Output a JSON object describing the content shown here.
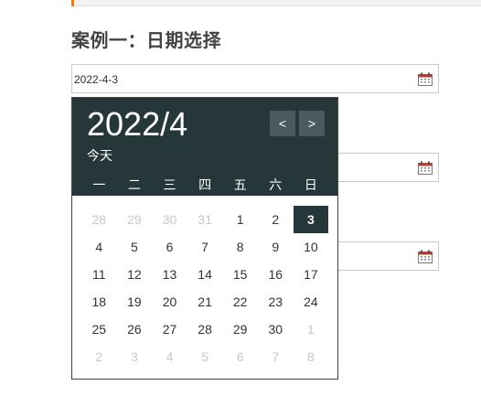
{
  "heading": "案例一：日期选择",
  "inputs": [
    {
      "value": "2022-4-3"
    },
    {
      "value": ""
    },
    {
      "value": ""
    }
  ],
  "picker": {
    "year_month": "2022/4",
    "today_label": "今天",
    "prev_label": "<",
    "next_label": ">",
    "weekdays": [
      "一",
      "二",
      "三",
      "四",
      "五",
      "六",
      "日"
    ],
    "selected_day": "3",
    "days": [
      {
        "label": "28",
        "other": true
      },
      {
        "label": "29",
        "other": true
      },
      {
        "label": "30",
        "other": true
      },
      {
        "label": "31",
        "other": true
      },
      {
        "label": "1"
      },
      {
        "label": "2"
      },
      {
        "label": "3",
        "selected": true
      },
      {
        "label": "4"
      },
      {
        "label": "5"
      },
      {
        "label": "6"
      },
      {
        "label": "7"
      },
      {
        "label": "8"
      },
      {
        "label": "9"
      },
      {
        "label": "10"
      },
      {
        "label": "11"
      },
      {
        "label": "12"
      },
      {
        "label": "13"
      },
      {
        "label": "14"
      },
      {
        "label": "15"
      },
      {
        "label": "16"
      },
      {
        "label": "17"
      },
      {
        "label": "18"
      },
      {
        "label": "19"
      },
      {
        "label": "20"
      },
      {
        "label": "21"
      },
      {
        "label": "22"
      },
      {
        "label": "23"
      },
      {
        "label": "24"
      },
      {
        "label": "25"
      },
      {
        "label": "26"
      },
      {
        "label": "27"
      },
      {
        "label": "28"
      },
      {
        "label": "29"
      },
      {
        "label": "30"
      },
      {
        "label": "1",
        "other": true
      },
      {
        "label": "2",
        "other": true
      },
      {
        "label": "3",
        "other": true
      },
      {
        "label": "4",
        "other": true
      },
      {
        "label": "5",
        "other": true
      },
      {
        "label": "6",
        "other": true
      },
      {
        "label": "7",
        "other": true
      },
      {
        "label": "8",
        "other": true
      }
    ]
  },
  "colors": {
    "header_bg": "#26373a",
    "accent": "#f07c00",
    "nav_btn_bg": "#4a5a5d",
    "muted_day": "#c8c8c8"
  },
  "icons": {
    "calendar": "calendar-icon"
  }
}
